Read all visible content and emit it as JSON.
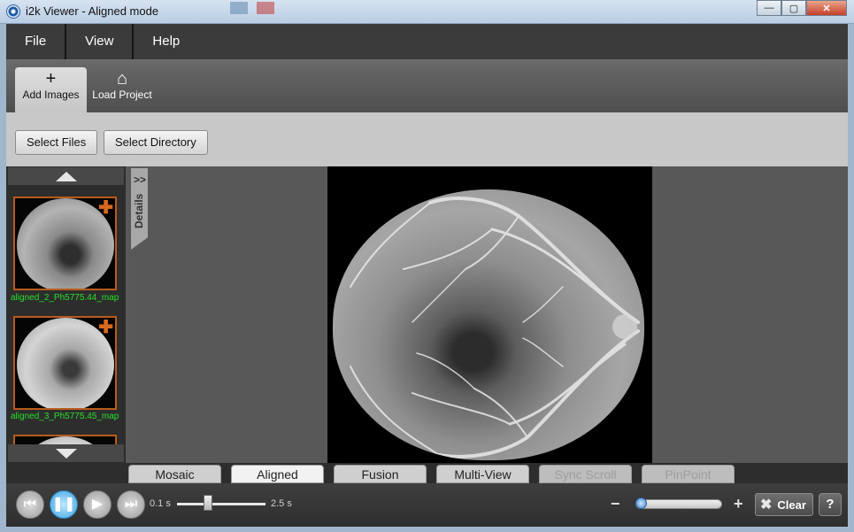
{
  "window": {
    "title": "i2k Viewer - Aligned mode",
    "controls": [
      "—",
      "▢",
      "✕"
    ]
  },
  "menu": [
    {
      "label": "File"
    },
    {
      "label": "View"
    },
    {
      "label": "Help"
    }
  ],
  "ribbon": [
    {
      "label": "Add Images",
      "icon": "plus-icon",
      "glyph": "+",
      "active": true
    },
    {
      "label": "Load Project",
      "icon": "home-outline-icon",
      "glyph": "⌂",
      "active": false
    }
  ],
  "toolbar": {
    "select_files": "Select Files",
    "select_directory": "Select Directory"
  },
  "thumbnails": [
    {
      "label": "aligned_2_Ph5775.44_map"
    },
    {
      "label": "aligned_3_Ph5775.45_map"
    }
  ],
  "details_tab": {
    "label": "Details",
    "chevron": ">>"
  },
  "mode_tabs": [
    {
      "label": "Mosaic",
      "state": "normal"
    },
    {
      "label": "Aligned",
      "state": "active"
    },
    {
      "label": "Fusion",
      "state": "normal"
    },
    {
      "label": "Multi-View",
      "state": "normal"
    },
    {
      "label": "Sync Scroll",
      "state": "disabled"
    },
    {
      "label": "PinPoint",
      "state": "disabled"
    }
  ],
  "playback": {
    "speed_min": "0.1 s",
    "speed_max": "2.5 s",
    "speed_value": 0.35,
    "zoom_value": 0.0,
    "zoom_minus": "−",
    "zoom_plus": "+",
    "clear_label": "Clear",
    "help_label": "?"
  },
  "colors": {
    "thumb_border": "#b85b1c",
    "thumb_label": "#28e02a",
    "play_active": "#3aa3e3"
  }
}
